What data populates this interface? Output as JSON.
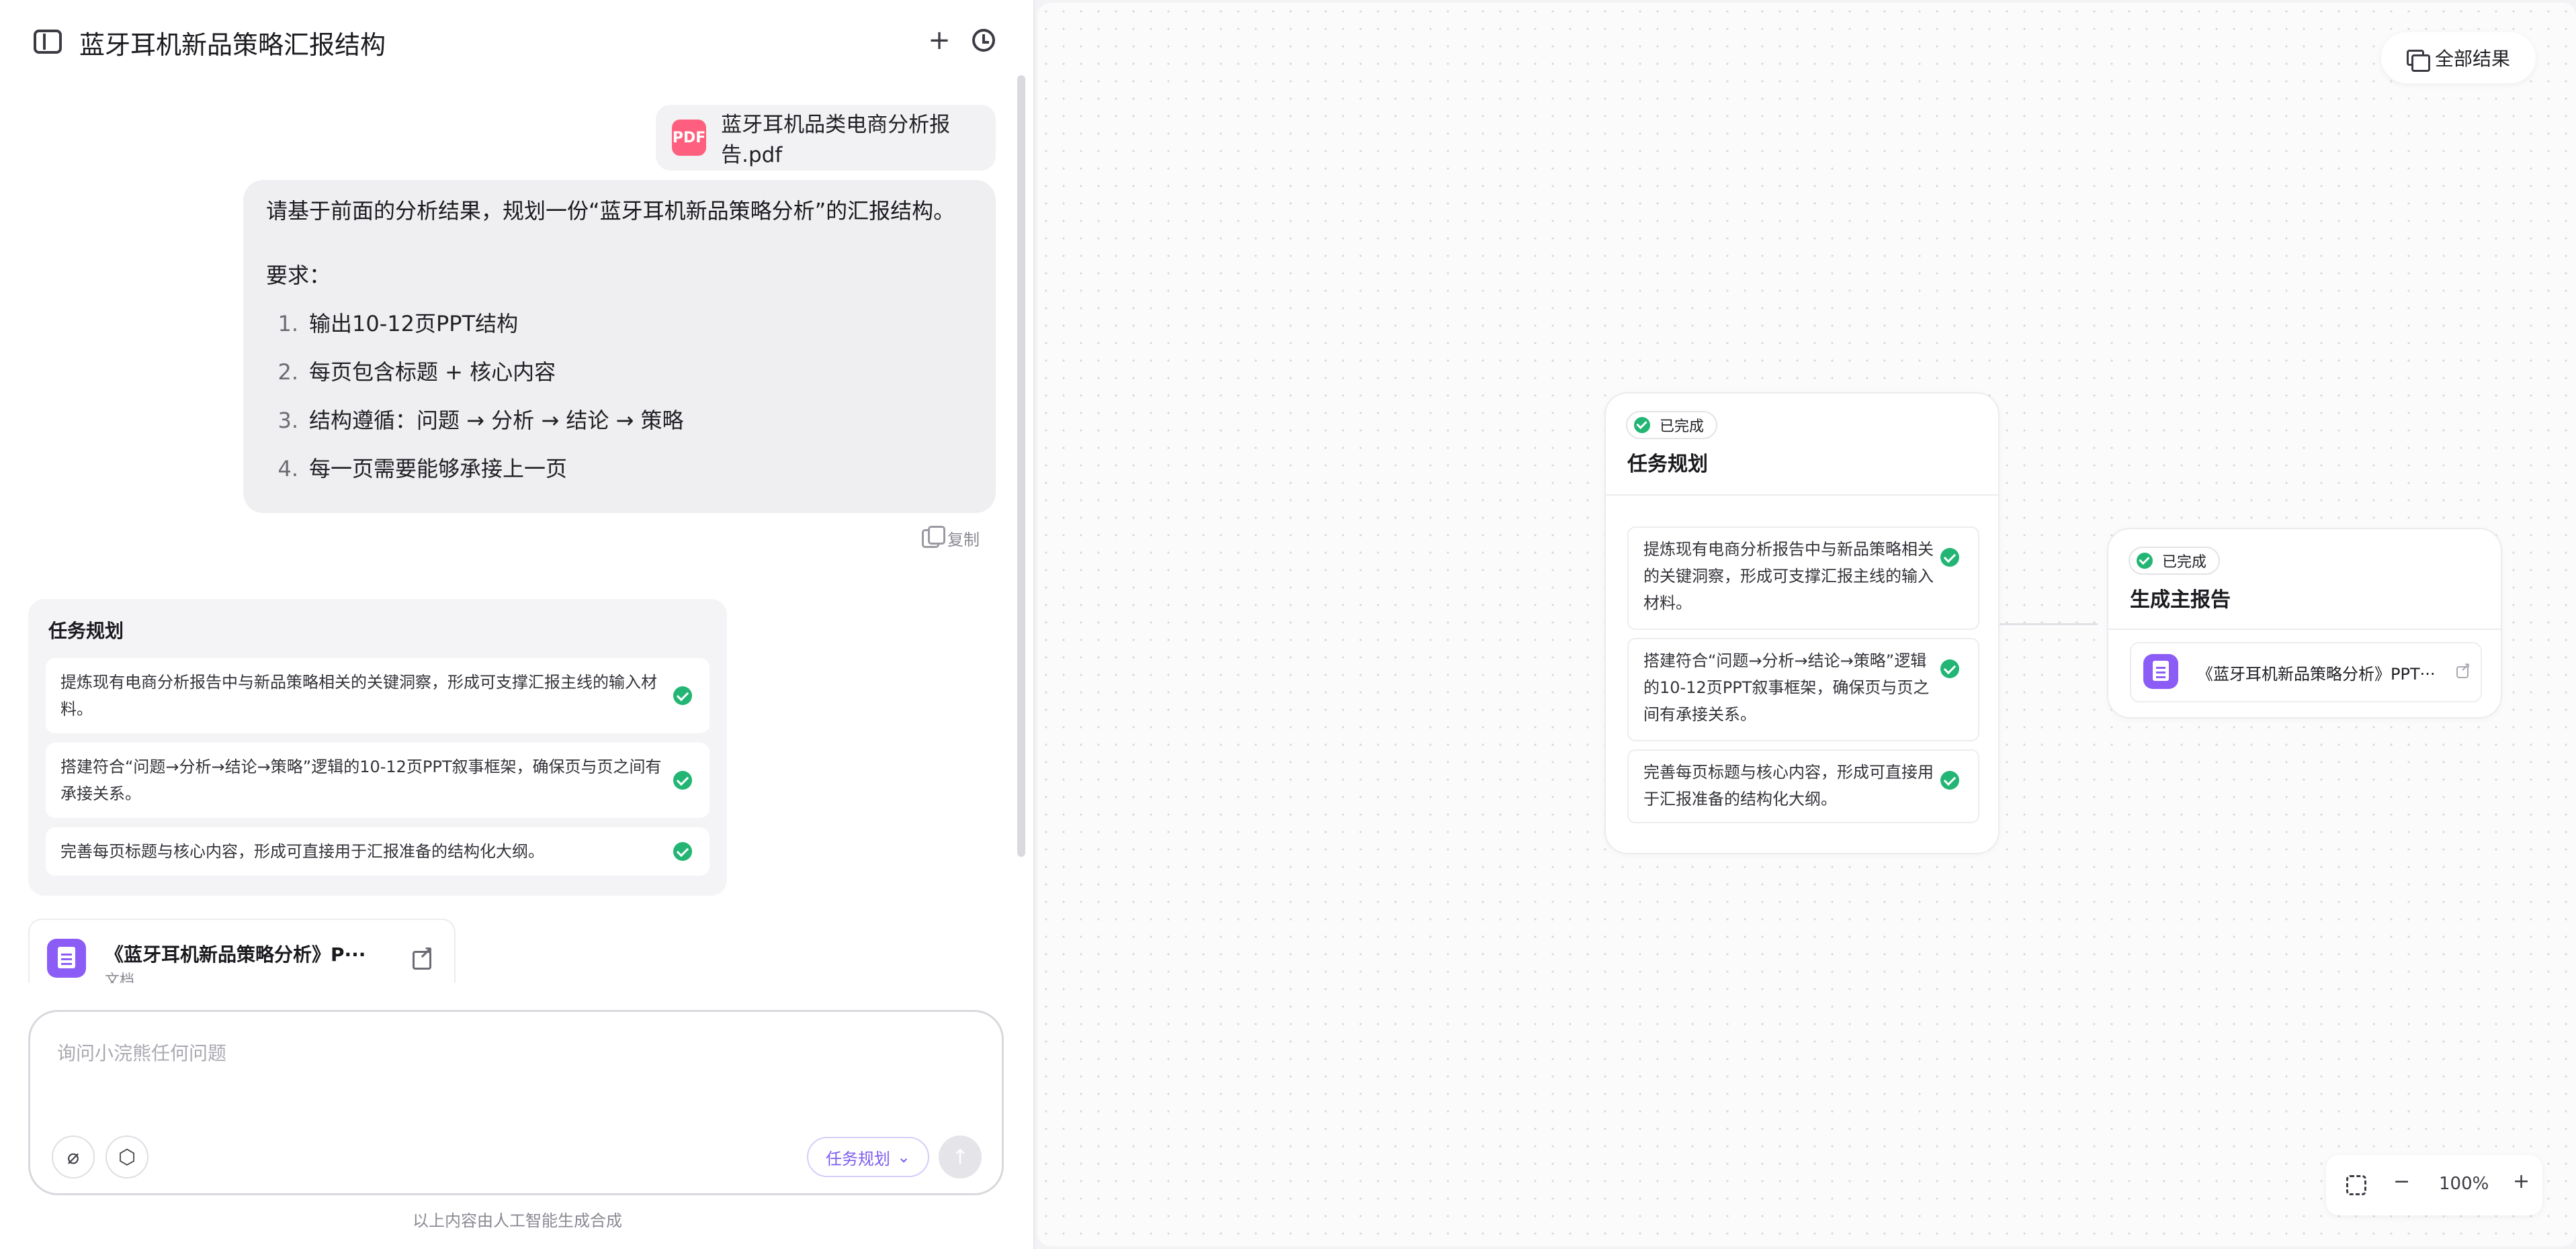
{
  "header": {
    "title": "蓝牙耳机新品策略汇报结构",
    "new_chat_icon": "+"
  },
  "attachment": {
    "file_name": "蓝牙耳机品类电商分析报告.pdf",
    "icon": "pdf-icon"
  },
  "user_message": {
    "line1": "请基于前面的分析结果，规划一份“蓝牙耳机新品策略分析”的汇报结构。",
    "line2": "要求：",
    "items": [
      {
        "num": "1.",
        "text": "输出10-12页PPT结构"
      },
      {
        "num": "2.",
        "text": "每页包含标题 + 核心内容"
      },
      {
        "num": "3.",
        "text": "结构遵循：问题 → 分析 → 结论 → 策略"
      },
      {
        "num": "4.",
        "text": "每一页需要能够承接上一页"
      }
    ],
    "copy_label": "复制"
  },
  "task_card": {
    "title": "任务规划",
    "items": [
      "提炼现有电商分析报告中与新品策略相关的关键洞察，形成可支撑汇报主线的输入材料。",
      "搭建符合“问题→分析→结论→策略”逻辑的10-12页PPT叙事框架，确保页与页之间有承接关系。",
      "完善每页标题与核心内容，形成可直接用于汇报准备的结构化大纲。"
    ]
  },
  "doc_card": {
    "title": "《蓝牙耳机新品策略分析》P···",
    "subtitle": "文档"
  },
  "composer": {
    "placeholder": "询问小浣熊任何问题",
    "mode_label": "任务规划",
    "send_icon": "↑"
  },
  "disclaimer": "以上内容由人工智能生成合成",
  "canvas": {
    "results_button": "全部结果",
    "plan_node": {
      "status": "已完成",
      "title": "任务规划",
      "items": [
        "提炼现有电商分析报告中与新品策略相关的关键洞察，形成可支撑汇报主线的输入材料。",
        "搭建符合“问题→分析→结论→策略”逻辑的10-12页PPT叙事框架，确保页与页之间有承接关系。",
        "完善每页标题与核心内容，形成可直接用于汇报准备的结构化大纲。"
      ]
    },
    "report_node": {
      "status": "已完成",
      "title": "生成主报告",
      "doc_title": "《蓝牙耳机新品策略分析》PPT···"
    },
    "zoom": {
      "minus": "−",
      "value": "100%",
      "plus": "+"
    }
  },
  "colors": {
    "accent_purple": "#8b5cf6",
    "success_green": "#22b573",
    "pdf_pink": "#ff5f7e"
  }
}
